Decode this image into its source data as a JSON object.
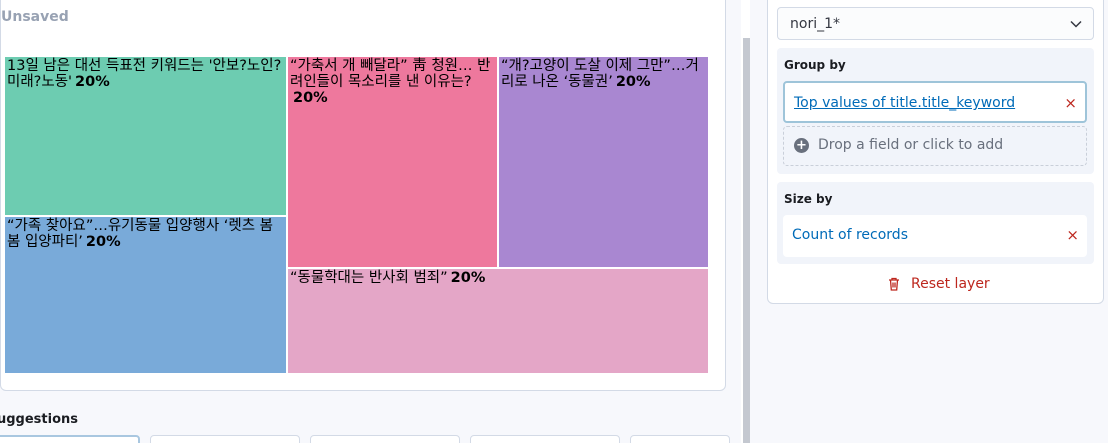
{
  "workspace": {
    "status": "Unsaved",
    "suggestions_label": "uggestions"
  },
  "treemap": {
    "cells": [
      {
        "label": "13일 남은 대선 득표전 키워드는 '안보?노인?미래?노동'",
        "percent": "20%",
        "color": "#6dccb1"
      },
      {
        "label": "“가족 찾아요”…유기동물 입양행사 ‘렛츠 봄봄 입양파티’",
        "percent": "20%",
        "color": "#79aad9"
      },
      {
        "label": "“가축서 개 빼달라” 靑 청원… 반려인들이 목소리를 낸 이유는?",
        "percent": "20%",
        "color": "#ee789d"
      },
      {
        "label": "“개?고양이 도살 이제 그만”…거리로 나온 ‘동물권’",
        "percent": "20%",
        "color": "#a987d1"
      },
      {
        "label": "“동물학대는 반사회 범죄”",
        "percent": "20%",
        "color": "#e4a6c7"
      }
    ]
  },
  "config": {
    "layer": "nori_1*",
    "group_by": {
      "title": "Group by",
      "field": "Top values of title.title_keyword",
      "drop_hint": "Drop a field or click to add"
    },
    "size_by": {
      "title": "Size by",
      "field": "Count of records"
    },
    "reset_label": "Reset layer",
    "remove_glyph": "×"
  }
}
